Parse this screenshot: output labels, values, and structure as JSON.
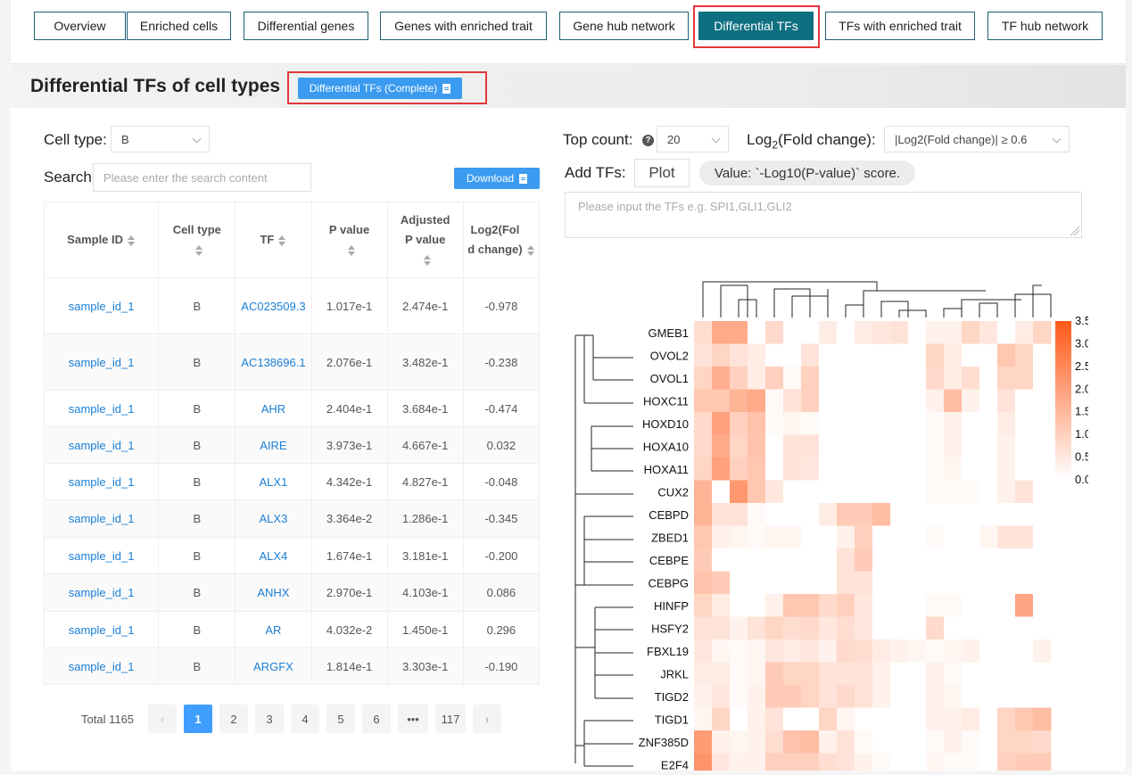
{
  "tabs": [
    {
      "label": "Overview",
      "active": false
    },
    {
      "label": "Enriched cells",
      "active": false
    },
    {
      "label": "Differential genes",
      "active": false
    },
    {
      "label": "Genes with enriched trait",
      "active": false
    },
    {
      "label": "Gene hub network",
      "active": false
    },
    {
      "label": "Differential TFs",
      "active": true
    },
    {
      "label": "TFs with enriched trait",
      "active": false
    },
    {
      "label": "TF hub network",
      "active": false
    }
  ],
  "header": {
    "title": "Differential TFs of cell types",
    "complete_button": "Differential TFs (Complete)"
  },
  "left": {
    "cell_type_label": "Cell type:",
    "cell_type_value": "B",
    "search_label": "Search:",
    "search_placeholder": "Please enter the search content",
    "download_label": "Download"
  },
  "table": {
    "headers": [
      "Sample ID",
      "Cell type",
      "TF",
      "P value",
      "Adjusted P value",
      "Log2(Fold change)"
    ],
    "rows": [
      {
        "sample": "sample_id_1",
        "cell": "B",
        "tf": "AC023509.3",
        "p": "1.017e-1",
        "adj": "2.474e-1",
        "fc": "-0.978"
      },
      {
        "sample": "sample_id_1",
        "cell": "B",
        "tf": "AC138696.1",
        "p": "2.076e-1",
        "adj": "3.482e-1",
        "fc": "-0.238"
      },
      {
        "sample": "sample_id_1",
        "cell": "B",
        "tf": "AHR",
        "p": "2.404e-1",
        "adj": "3.684e-1",
        "fc": "-0.474"
      },
      {
        "sample": "sample_id_1",
        "cell": "B",
        "tf": "AIRE",
        "p": "3.973e-1",
        "adj": "4.667e-1",
        "fc": "0.032"
      },
      {
        "sample": "sample_id_1",
        "cell": "B",
        "tf": "ALX1",
        "p": "4.342e-1",
        "adj": "4.827e-1",
        "fc": "-0.048"
      },
      {
        "sample": "sample_id_1",
        "cell": "B",
        "tf": "ALX3",
        "p": "3.364e-2",
        "adj": "1.286e-1",
        "fc": "-0.345"
      },
      {
        "sample": "sample_id_1",
        "cell": "B",
        "tf": "ALX4",
        "p": "1.674e-1",
        "adj": "3.181e-1",
        "fc": "-0.200"
      },
      {
        "sample": "sample_id_1",
        "cell": "B",
        "tf": "ANHX",
        "p": "2.970e-1",
        "adj": "4.103e-1",
        "fc": "0.086"
      },
      {
        "sample": "sample_id_1",
        "cell": "B",
        "tf": "AR",
        "p": "4.032e-2",
        "adj": "1.450e-1",
        "fc": "0.296"
      },
      {
        "sample": "sample_id_1",
        "cell": "B",
        "tf": "ARGFX",
        "p": "1.814e-1",
        "adj": "3.303e-1",
        "fc": "-0.190"
      }
    ]
  },
  "pagination": {
    "total": "Total 1165",
    "pages": [
      "1",
      "2",
      "3",
      "4",
      "5",
      "6",
      "•••",
      "117"
    ],
    "current": "1"
  },
  "right": {
    "top_count_label": "Top count:",
    "top_count_value": "20",
    "fold_label_prefix": "Log",
    "fold_label_sub": "2",
    "fold_label_suffix": "(Fold change):",
    "fold_value": "|Log2(Fold change)| ≥ 0.6",
    "add_tfs_label": "Add TFs:",
    "plot_button": "Plot",
    "value_tag": "Value: `-Log10(P-value)` score.",
    "tfs_placeholder": "Please input the TFs  e.g. SPI1,GLI1,GLI2"
  },
  "chart_data": {
    "type": "heatmap",
    "rows": [
      "GMEB1",
      "OVOL2",
      "OVOL1",
      "HOXC11",
      "HOXD10",
      "HOXA10",
      "HOXA11",
      "CUX2",
      "CEBPD",
      "ZBED1",
      "CEBPE",
      "CEBPG",
      "HINFP",
      "HSFY2",
      "FBXL19",
      "JRKL",
      "TIGD2",
      "TIGD1",
      "ZNF385D",
      "E2F4"
    ],
    "n_columns": 20,
    "colorbar_ticks": [
      "3.5",
      "3.0",
      "2.5",
      "2.0",
      "1.5",
      "1.0",
      "0.5",
      "0.0"
    ],
    "vmin": 0,
    "vmax": 3.5,
    "colors": {
      "low": "#ffffff",
      "high": "#ff5a1a"
    },
    "values": [
      [
        0.7,
        1.8,
        1.8,
        0,
        0.8,
        0,
        0,
        0.4,
        0,
        0.4,
        0.5,
        0.6,
        0,
        0.3,
        0.3,
        0.9,
        0.5,
        0,
        0.4,
        0.9
      ],
      [
        0.6,
        0.9,
        0.6,
        0.4,
        0,
        0,
        0.6,
        0,
        0,
        0,
        0,
        0,
        0,
        0.9,
        0.4,
        0,
        0,
        1.2,
        0.9,
        0
      ],
      [
        0.9,
        1.7,
        1.0,
        0.4,
        1.0,
        0.1,
        1.0,
        0,
        0,
        0,
        0,
        0,
        0,
        0.8,
        0.4,
        0.7,
        0,
        0.9,
        0.9,
        0
      ],
      [
        1.2,
        1.2,
        1.6,
        1.8,
        0.1,
        0.6,
        1.0,
        0,
        0,
        0,
        0,
        0,
        0,
        0.3,
        1.4,
        0.3,
        0,
        0.6,
        0,
        0
      ],
      [
        0.8,
        2.0,
        1.0,
        1.3,
        0.1,
        0.2,
        0.1,
        0,
        0,
        0,
        0,
        0,
        0,
        0.1,
        0.3,
        0,
        0,
        0.4,
        0,
        0
      ],
      [
        0.8,
        1.8,
        0.9,
        1.3,
        0,
        0.6,
        0.6,
        0,
        0,
        0,
        0,
        0,
        0,
        0.1,
        0.3,
        0,
        0,
        0.3,
        0,
        0
      ],
      [
        0.9,
        2.0,
        1.0,
        1.2,
        0,
        0.6,
        0.5,
        0,
        0,
        0,
        0,
        0,
        0,
        0.1,
        0.2,
        0,
        0,
        0.3,
        0,
        0
      ],
      [
        1.6,
        0,
        2.2,
        1.2,
        0.5,
        0,
        0,
        0,
        0,
        0,
        0,
        0,
        0,
        0.1,
        0.1,
        0.1,
        0,
        0.3,
        0.6,
        0,
        0.7
      ],
      [
        1.6,
        0.6,
        0.6,
        0.1,
        0,
        0,
        0,
        0.4,
        1.1,
        1.1,
        1.4,
        0,
        0,
        0,
        0,
        0,
        0,
        0,
        0,
        0
      ],
      [
        1.2,
        0.3,
        0.2,
        0.1,
        0.2,
        0.2,
        0,
        0,
        0.3,
        1.0,
        0,
        0,
        0,
        0.1,
        0,
        0,
        0.2,
        0.6,
        0.6,
        0
      ],
      [
        1.1,
        0,
        0,
        0,
        0,
        0,
        0,
        0,
        0.6,
        1.1,
        0,
        0,
        0,
        0,
        0,
        0,
        0,
        0,
        0,
        0
      ],
      [
        1.3,
        1.1,
        0,
        0,
        0,
        0,
        0,
        0,
        0.6,
        0.6,
        0,
        0,
        0,
        0,
        0,
        0,
        0,
        0,
        0,
        0
      ],
      [
        0.9,
        0.4,
        0,
        0,
        0.3,
        1.2,
        1.2,
        0.8,
        1.0,
        0.5,
        0,
        0,
        0,
        0.1,
        0.1,
        0,
        0,
        0,
        1.9,
        0
      ],
      [
        0.6,
        0.6,
        0.3,
        0.6,
        0.9,
        0.7,
        0.8,
        0.5,
        0.7,
        0.5,
        0,
        0,
        0,
        0.8,
        0,
        0,
        0,
        0,
        0,
        0
      ],
      [
        0.5,
        0.2,
        0.1,
        0.2,
        0.5,
        0.4,
        0.5,
        0.3,
        0.8,
        0.7,
        0.4,
        0.3,
        0.2,
        0.1,
        0.2,
        0.3,
        0,
        0,
        0,
        0.3
      ],
      [
        0.4,
        0.4,
        0.1,
        0.2,
        1.1,
        0.9,
        0.9,
        0.6,
        0.6,
        0.6,
        0.3,
        0,
        0,
        0.3,
        0.1,
        0,
        0,
        0,
        0,
        0
      ],
      [
        0.3,
        0.5,
        0.1,
        0.3,
        1.1,
        1.1,
        0.9,
        0.6,
        0.8,
        0.6,
        0.3,
        0,
        0,
        0.3,
        0.2,
        0,
        0,
        0,
        0,
        0
      ],
      [
        0.2,
        0.9,
        0,
        0.3,
        0.6,
        0,
        0,
        0.9,
        0.2,
        0,
        0,
        0,
        0,
        0.3,
        0.3,
        0.4,
        0,
        0.9,
        1.2,
        1.4,
        2.1
      ],
      [
        2.1,
        0.3,
        0.2,
        0.3,
        0.7,
        1.3,
        1.4,
        0.3,
        0.6,
        0.1,
        0,
        0,
        0,
        0.1,
        0.3,
        0.1,
        0,
        0.9,
        0.9,
        0.8
      ],
      [
        2.3,
        0.5,
        0.3,
        0.3,
        1.0,
        1.0,
        1.0,
        0.7,
        0.6,
        0.3,
        0.1,
        0,
        0,
        0.2,
        0.1,
        0.1,
        0,
        1.0,
        1.1,
        1.1
      ]
    ]
  }
}
